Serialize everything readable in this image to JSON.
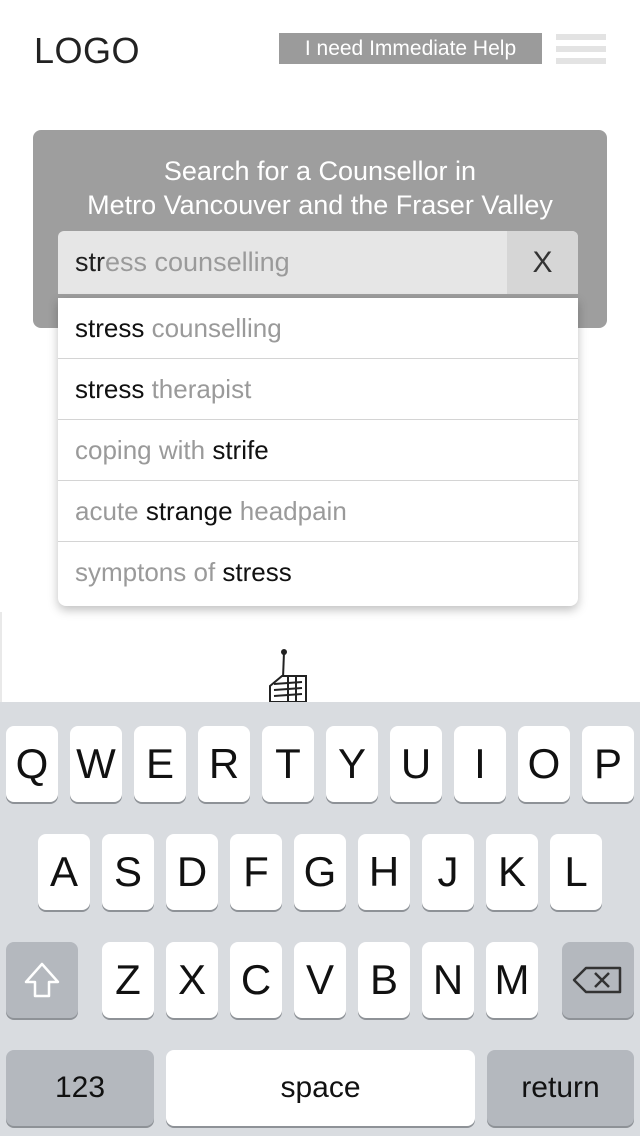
{
  "header": {
    "logo": "LOGO",
    "help_button": "I need Immediate Help",
    "menu_icon": "hamburger-menu-icon"
  },
  "search": {
    "title_line1": "Search for a Counsellor in",
    "title_line2": "Metro Vancouver and the Fraser Valley",
    "typed_text": "str",
    "autocomplete_text": "ess counselling",
    "clear_label": "X"
  },
  "suggestions": [
    {
      "parts": [
        {
          "text": "stress",
          "bold": true
        },
        {
          "text": " counselling",
          "bold": false
        }
      ]
    },
    {
      "parts": [
        {
          "text": "stress",
          "bold": true
        },
        {
          "text": " therapist",
          "bold": false
        }
      ]
    },
    {
      "parts": [
        {
          "text": "coping with ",
          "bold": false
        },
        {
          "text": "strife",
          "bold": true
        }
      ]
    },
    {
      "parts": [
        {
          "text": "acute ",
          "bold": false
        },
        {
          "text": "strange",
          "bold": true
        },
        {
          "text": " headpain",
          "bold": false
        }
      ]
    },
    {
      "parts": [
        {
          "text": "symptons of ",
          "bold": false
        },
        {
          "text": "stress",
          "bold": true
        }
      ]
    }
  ],
  "keyboard": {
    "row1": [
      "Q",
      "W",
      "E",
      "R",
      "T",
      "Y",
      "U",
      "I",
      "O",
      "P"
    ],
    "row2": [
      "A",
      "S",
      "D",
      "F",
      "G",
      "H",
      "J",
      "K",
      "L"
    ],
    "row3": [
      "Z",
      "X",
      "C",
      "V",
      "B",
      "N",
      "M"
    ],
    "shift_icon": "shift-icon",
    "delete_icon": "backspace-icon",
    "numbers_label": "123",
    "space_label": "space",
    "return_label": "return"
  }
}
